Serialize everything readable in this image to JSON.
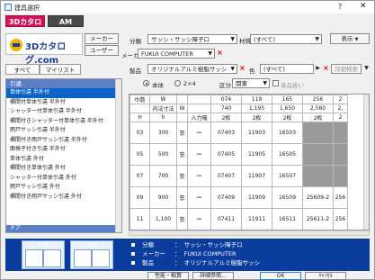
{
  "window": {
    "title": "建具選択",
    "help": "?",
    "close": "✕"
  },
  "tabs": {
    "active": "3Dカタログ",
    "inactive": "AM"
  },
  "catalog": {
    "logo_text": "3Dカタログ.com",
    "maker_btn": "メーカー",
    "user_btn": "ユーザー"
  },
  "filters": {
    "bunrui_label": "分類",
    "bunrui_value": "サッシ・サッシ障子口",
    "zaishitsu_label": "材質",
    "zaishitsu_value": "(すべて)",
    "maker_label": "メーカー",
    "maker_value": "FUKUI COMPUTER",
    "seihin_label": "製品",
    "seihin_value": "オリジナルアルミ樹脂サッシ",
    "iro_label": "色",
    "iro_value": "(すべて)",
    "kubun_label": "区分",
    "kubun_value": "関東",
    "single_label": "単品扱い",
    "radio1": "本体",
    "radio2": "2×4",
    "display_btn": "表示",
    "detail_search": "詳細検索"
  },
  "left": {
    "tab_all": "すべて",
    "tab_my": "マイリスト",
    "header": "引違",
    "items": [
      "単体引違 半外付",
      "欄間付単体引違 半外付",
      "シャッター付単体引違 半外付",
      "欄間付きシャッター付単体引違 半外付",
      "雨戸サッシ引違 半外付",
      "欄間付き雨戸サッシ引違 半外付",
      "面格子付き引違 半外付",
      "単体引違 外付",
      "欄間付き単体引違 外付",
      "シャッター付単体引違 外付",
      "雨戸サッシ引違 外付",
      "欄間付き雨戸サッシ引違 外付"
    ],
    "footer": "ドア"
  },
  "grid": {
    "head1": [
      "巾数",
      "W",
      "",
      "074",
      "119",
      "165",
      "256",
      "2"
    ],
    "head2": [
      "",
      "内法寸法",
      "W",
      "",
      "740",
      "1,195",
      "1,650",
      "2,560",
      "2,"
    ],
    "head3": [
      "H",
      "h",
      "",
      "入力幅",
      "2枚",
      "2枚",
      "2枚",
      "2枚",
      "2"
    ],
    "rows": [
      {
        "h": "03",
        "hh": "300",
        "mark": "窓",
        "input": "—",
        "c1": "07403",
        "c2": "11903",
        "c3": "16503",
        "c4": "",
        "c5": ""
      },
      {
        "h": "05",
        "hh": "500",
        "mark": "窓",
        "input": "—",
        "c1": "07405",
        "c2": "11905",
        "c3": "16505",
        "c4": "",
        "c5": ""
      },
      {
        "h": "07",
        "hh": "700",
        "mark": "窓",
        "input": "—",
        "c1": "07407",
        "c2": "11907",
        "c3": "16507",
        "c4": "",
        "c5": ""
      },
      {
        "h": "09",
        "hh": "900",
        "mark": "窓",
        "input": "—",
        "c1": "07409",
        "c2": "11909",
        "c3": "16509",
        "c4": "25609-2",
        "c5": "256"
      },
      {
        "h": "11",
        "hh": "1,100",
        "mark": "窓",
        "input": "—",
        "c1": "07411",
        "c2": "11911",
        "c3": "16511",
        "c4": "25611-2",
        "c5": "256"
      }
    ]
  },
  "preview": {
    "outer_label": "外観",
    "inner_label": "内観",
    "info": [
      {
        "k": "分類",
        "v": "サッシ・サッシ障子口"
      },
      {
        "k": "メーカー",
        "v": "FUKUI COMPUTER"
      },
      {
        "k": "製品",
        "v": "オリジナルアルミ樹脂サッシ"
      }
    ]
  },
  "buttons": {
    "perf": "性能・積算",
    "detail": "詳細参照...",
    "ok": "OK",
    "cancel": "ｷｬﾝｾﾙ"
  },
  "colors": {
    "accent": "#d4145a",
    "selection": "#0a64c8",
    "preview_bg": "#0b3d9e"
  }
}
